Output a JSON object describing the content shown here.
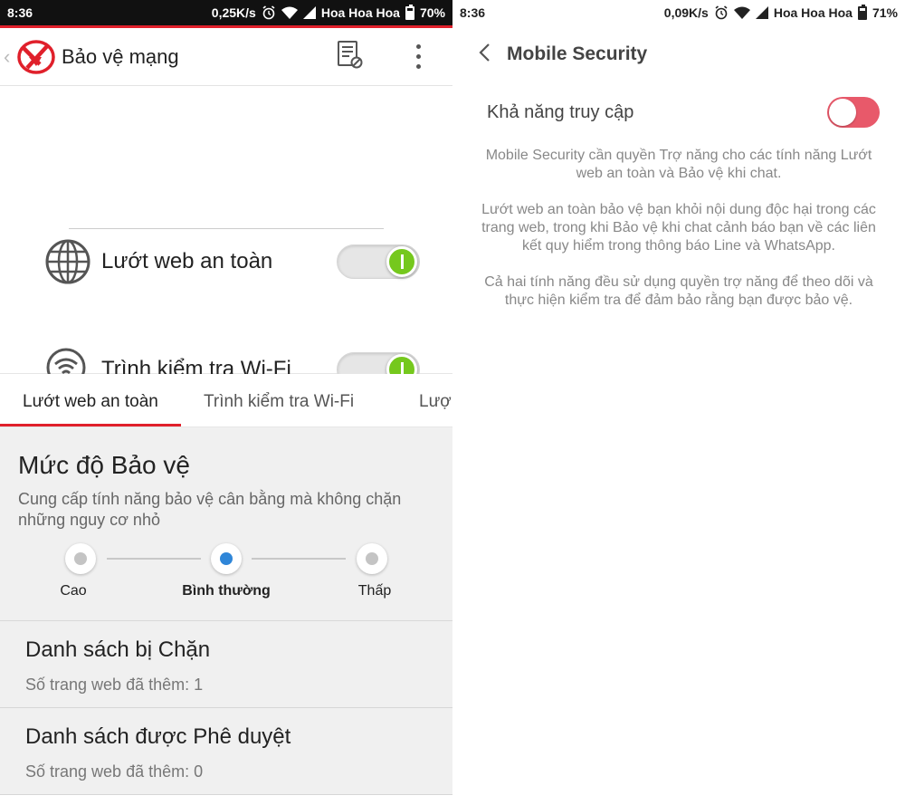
{
  "left": {
    "status": {
      "time": "8:36",
      "speed": "0,25K/s",
      "carrier": "Hoa Hoa Hoa",
      "battery": "70%"
    },
    "toolbar": {
      "title": "Bảo vệ mạng"
    },
    "features": [
      {
        "label": "Lướt web an toàn",
        "enabled": true
      },
      {
        "label": "Trình kiểm tra Wi-Fi",
        "enabled": true
      }
    ],
    "tabs": [
      "Lướt web an toàn",
      "Trình kiểm tra Wi-Fi",
      "Lượ"
    ],
    "active_tab": 0,
    "protection": {
      "title": "Mức độ Bảo vệ",
      "description": "Cung cấp tính năng bảo vệ cân bằng mà không chặn những nguy cơ nhỏ",
      "levels": [
        "Cao",
        "Bình thường",
        "Thấp"
      ],
      "selected": 1
    },
    "lists": [
      {
        "title": "Danh sách bị Chặn",
        "subtitle": "Số trang web đã thêm: 1"
      },
      {
        "title": "Danh sách được Phê duyệt",
        "subtitle": "Số trang web đã thêm: 0"
      }
    ],
    "colors": {
      "accent": "#e0202b",
      "toggle_on": "#75c81d",
      "selected_dot": "#2f86d8"
    }
  },
  "right": {
    "status": {
      "time": "8:36",
      "speed": "0,09K/s",
      "carrier": "Hoa Hoa Hoa",
      "battery": "71%"
    },
    "toolbar": {
      "title": "Mobile Security"
    },
    "accessibility": {
      "label": "Khả năng truy cập",
      "enabled": false
    },
    "paragraphs": [
      "Mobile Security cần quyền Trợ năng cho các tính năng Lướt web an toàn và Bảo vệ khi chat.",
      "Lướt web an toàn bảo vệ bạn khỏi nội dung độc hại trong các trang web, trong khi Bảo vệ khi chat cảnh báo bạn về các liên kết quy hiểm trong thông báo Line và WhatsApp.",
      "Cả hai tính năng đều sử dụng quyền trợ năng để theo dõi và thực hiện kiểm tra để đảm bảo rằng bạn được bảo vệ."
    ],
    "colors": {
      "toggle_off": "#e8596a"
    }
  }
}
